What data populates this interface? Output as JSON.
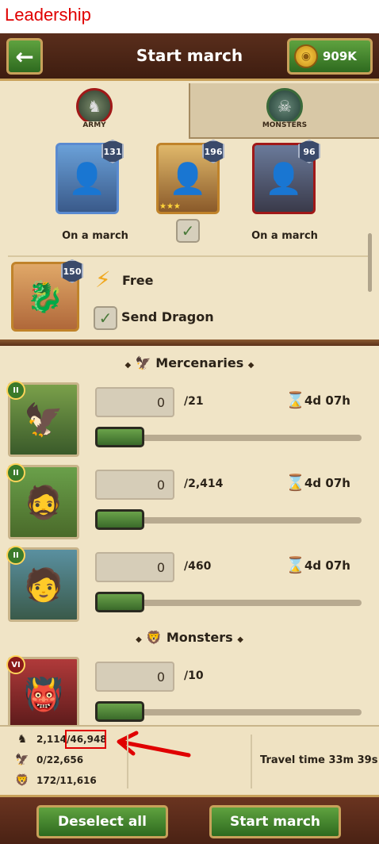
{
  "caption": "Leadership",
  "header": {
    "title": "Start march",
    "gold": "909K"
  },
  "tabs": [
    {
      "label": "ARMY"
    },
    {
      "label": "MONSTERS"
    }
  ],
  "heroes": [
    {
      "level": "131",
      "status": "On a march"
    },
    {
      "level": "196",
      "stars": "★★★"
    },
    {
      "level": "96",
      "status": "On a march"
    }
  ],
  "dragon": {
    "level": "150",
    "free_label": "Free",
    "send_label": "Send Dragon"
  },
  "sections": {
    "mercenaries": "Mercenaries",
    "monsters": "Monsters"
  },
  "units": [
    {
      "tier": "II",
      "value": "0",
      "max": "/21",
      "time": "4d 07h",
      "slider_fraction": 0
    },
    {
      "tier": "II",
      "value": "0",
      "max": "/2,414",
      "time": "4d 07h",
      "slider_fraction": 0
    },
    {
      "tier": "II",
      "value": "0",
      "max": "/460",
      "time": "4d 07h",
      "slider_fraction": 0
    },
    {
      "tier": "VI",
      "value": "0",
      "max": "/10",
      "slider_fraction": 0
    }
  ],
  "footer": {
    "leadership_used": "2,114",
    "leadership_max": "/46,948",
    "mercenaries": "0/22,656",
    "monsters": "172/11,616",
    "travel_time": "Travel time 33m 39s"
  },
  "buttons": {
    "deselect": "Deselect all",
    "start": "Start march"
  },
  "colors": {
    "accent_green": "#3a7a2a",
    "highlight_red": "#e00000"
  }
}
